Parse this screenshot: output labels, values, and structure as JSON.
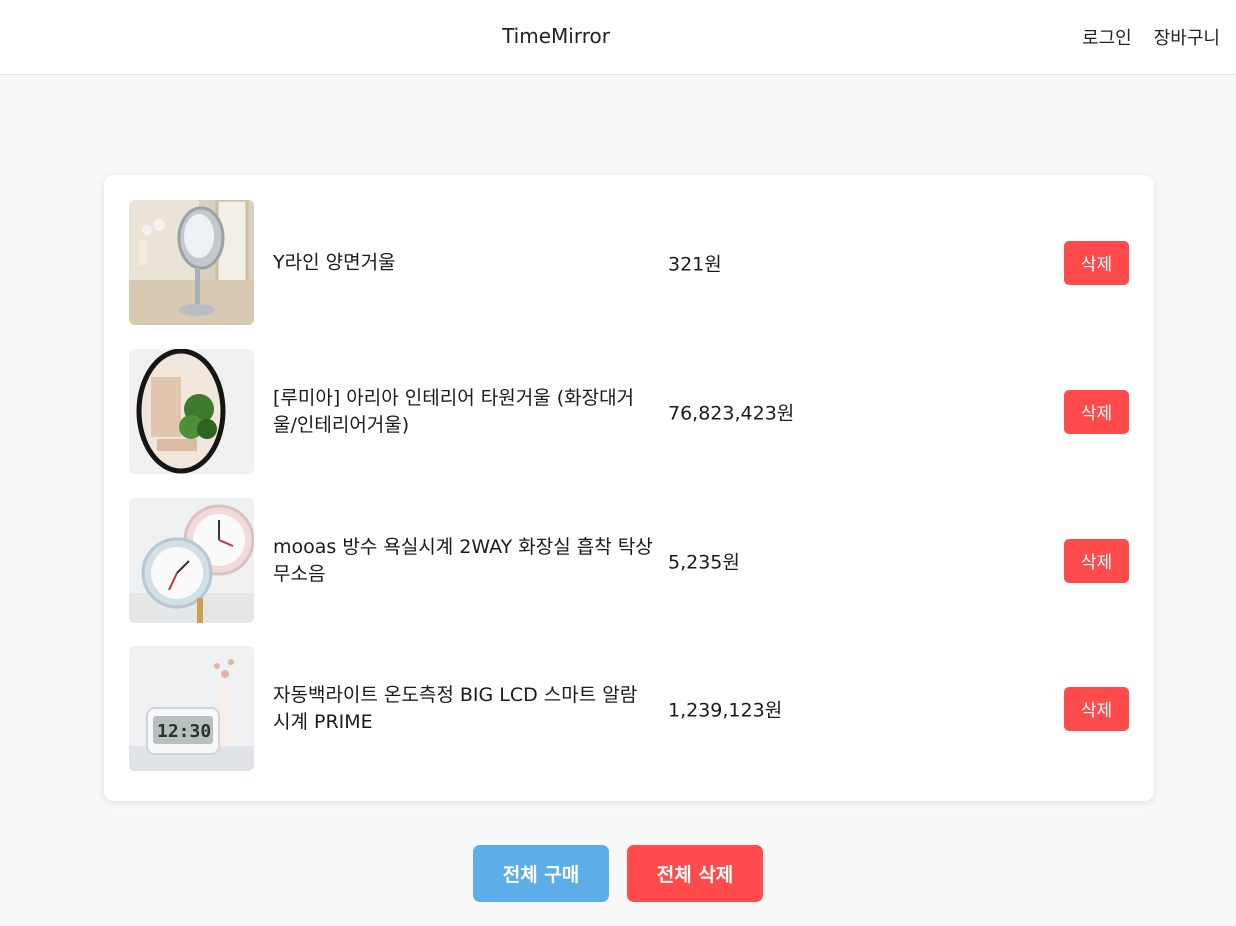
{
  "header": {
    "brand": "TimeMirror",
    "nav": {
      "login": "로그인",
      "cart": "장바구니"
    }
  },
  "cart": {
    "items": [
      {
        "image": "vanity-mirror-photo",
        "name": "Y라인 양면거울",
        "price": "321원",
        "delete_label": "삭제"
      },
      {
        "image": "oval-wall-mirror-photo",
        "name": "[루미아] 아리아 인테리어 타원거울 (화장대거울/인테리어거울)",
        "price": "76,823,423원",
        "delete_label": "삭제"
      },
      {
        "image": "bathroom-clock-photo",
        "name": "mooas 방수 욕실시계 2WAY 화장실 흡착 탁상 무소음",
        "price": "5,235원",
        "delete_label": "삭제"
      },
      {
        "image": "lcd-alarm-clock-photo",
        "name": "자동백라이트 온도측정 BIG LCD 스마트 알람시계 PRIME",
        "price": "1,239,123원",
        "delete_label": "삭제"
      }
    ],
    "lcd_display": "12:30"
  },
  "actions": {
    "buy_all": "전체 구매",
    "delete_all": "전체 삭제"
  },
  "colors": {
    "delete": "#ff4b4b",
    "buy": "#5dade9",
    "background": "#f8f8f8"
  }
}
